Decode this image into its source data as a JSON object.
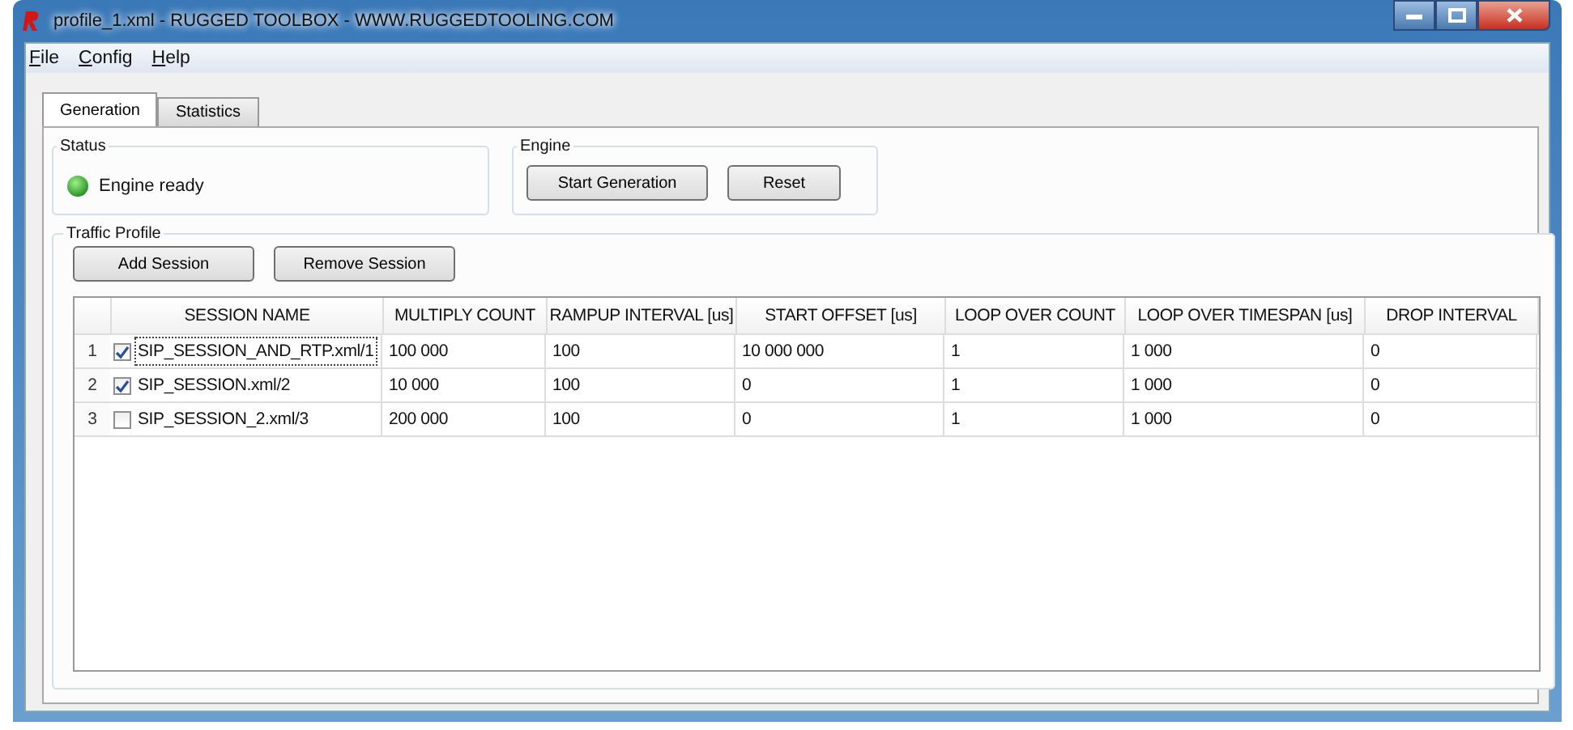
{
  "window": {
    "title": "profile_1.xml - RUGGED TOOLBOX - WWW.RUGGEDTOOLING.COM"
  },
  "menu": [
    "File",
    "Config",
    "Help"
  ],
  "tabs": [
    {
      "label": "Generation",
      "selected": true
    },
    {
      "label": "Statistics",
      "selected": false
    }
  ],
  "status": {
    "title": "Status",
    "text": "Engine ready",
    "ready": true
  },
  "engine": {
    "title": "Engine",
    "buttons": [
      "Start Generation",
      "Reset"
    ]
  },
  "traffic_profile": {
    "title": "Traffic Profile",
    "buttons": [
      "Add Session",
      "Remove Session"
    ],
    "table": {
      "columns": [
        "SESSION NAME",
        "MULTIPLY COUNT",
        "RAMPUP INTERVAL [us]",
        "START OFFSET [us]",
        "LOOP OVER COUNT",
        "LOOP OVER TIMESPAN [us]",
        "DROP INTERVAL"
      ],
      "rows": [
        {
          "number": "1",
          "checked": true,
          "focused": true,
          "cells": [
            "SIP_SESSION_AND_RTP.xml/1",
            "100 000",
            "100",
            "10 000 000",
            "1",
            "1 000",
            "0"
          ]
        },
        {
          "number": "2",
          "checked": true,
          "focused": false,
          "cells": [
            "SIP_SESSION.xml/2",
            "10 000",
            "100",
            "0",
            "1",
            "1 000",
            "0"
          ]
        },
        {
          "number": "3",
          "checked": false,
          "focused": false,
          "cells": [
            "SIP_SESSION_2.xml/3",
            "200 000",
            "100",
            "0",
            "1",
            "1 000",
            "0"
          ]
        }
      ]
    }
  }
}
